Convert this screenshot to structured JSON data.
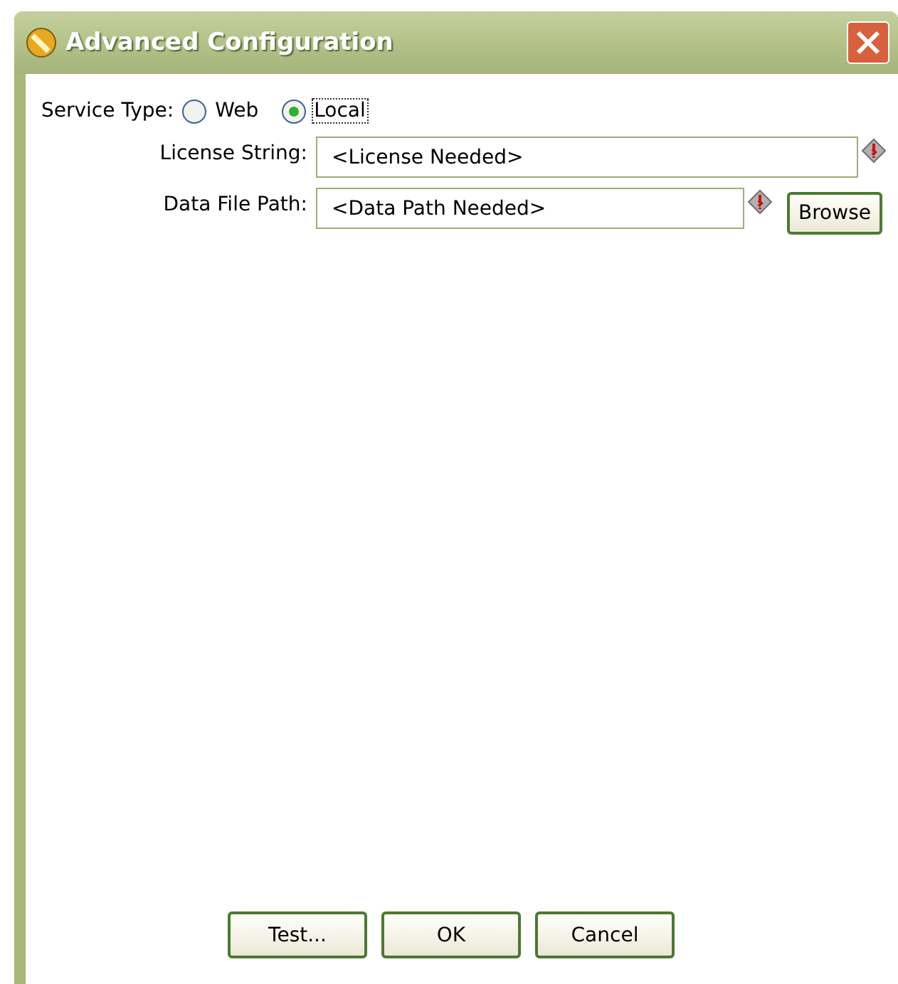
{
  "window": {
    "title": "Advanced Configuration"
  },
  "service_type": {
    "label": "Service Type:",
    "options": [
      {
        "label": "Web",
        "selected": false
      },
      {
        "label": "Local",
        "selected": true
      }
    ]
  },
  "fields": [
    {
      "label": "License String:",
      "value": "<License Needed>"
    },
    {
      "label": "Data File Path:",
      "value": "<Data Path Needed>",
      "browse_label": "Browse"
    }
  ],
  "buttons": [
    "Test...",
    "OK",
    "Cancel"
  ]
}
